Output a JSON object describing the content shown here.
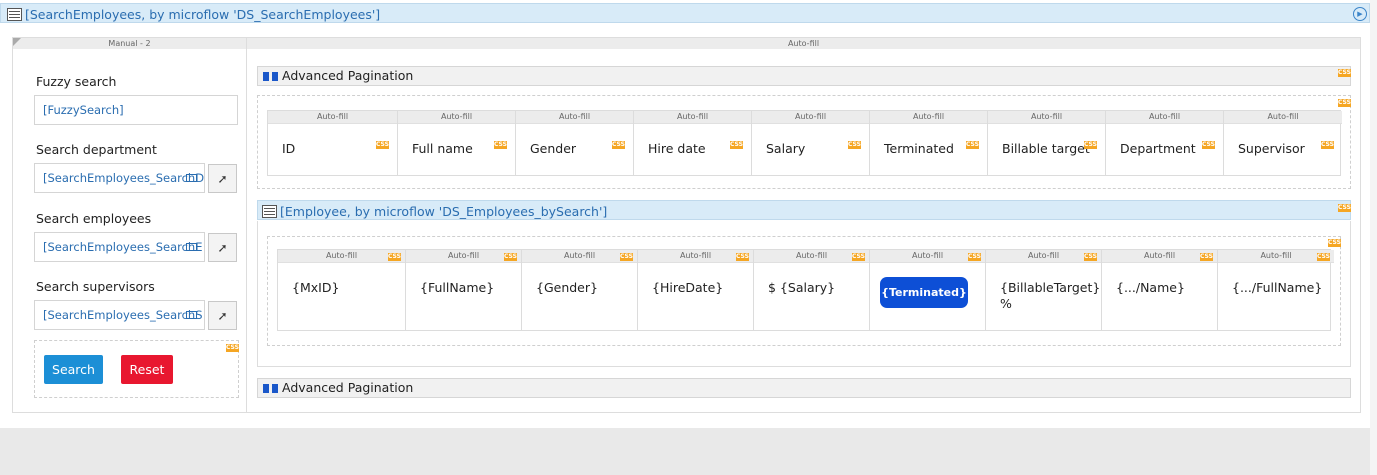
{
  "dataview": {
    "header_title": "[SearchEmployees, by microflow 'DS_SearchEmployees']"
  },
  "layout": {
    "left_col_header": "Manual - 2",
    "right_col_header": "Auto-fill"
  },
  "search_form": {
    "fuzzy_label": "Fuzzy search",
    "fuzzy_value": "[FuzzySearch]",
    "department_label": "Search department",
    "department_value": "[SearchEmployees_SearchD",
    "employees_label": "Search employees",
    "employees_value": "[SearchEmployees_SearchE",
    "supervisors_label": "Search supervisors",
    "supervisors_value": "[SearchEmployees_SearchS",
    "search_button": "Search",
    "reset_button": "Reset"
  },
  "pagination_top": {
    "label": "Advanced Pagination"
  },
  "pagination_bottom": {
    "label": "Advanced Pagination"
  },
  "header_table": {
    "autofill": "Auto-fill",
    "columns": [
      "ID",
      "Full name",
      "Gender",
      "Hire date",
      "Salary",
      "Terminated",
      "Billable target",
      "Department",
      "Supervisor"
    ]
  },
  "listview": {
    "header_title": "[Employee, by microflow 'DS_Employees_bySearch']",
    "autofill": "Auto-fill",
    "cells": [
      "{MxID}",
      "{FullName}",
      "{Gender}",
      "{HireDate}",
      "$ {Salary}",
      "{Terminated}",
      "{BillableTarget}",
      "{.../Name}",
      "{.../FullName}"
    ],
    "cell_suffix": "%"
  },
  "badge_text": "CSS",
  "colors": {
    "accent_blue": "#1c8fd6",
    "reset_red": "#e8172f",
    "terminated_badge": "#0d4fd6",
    "css_badge": "#f5a623"
  },
  "icons": [
    "dataview-icon",
    "listview-icon",
    "pagination-icon",
    "arrow-icon",
    "circle-arrow-icon",
    "reference-selector-icon"
  ]
}
